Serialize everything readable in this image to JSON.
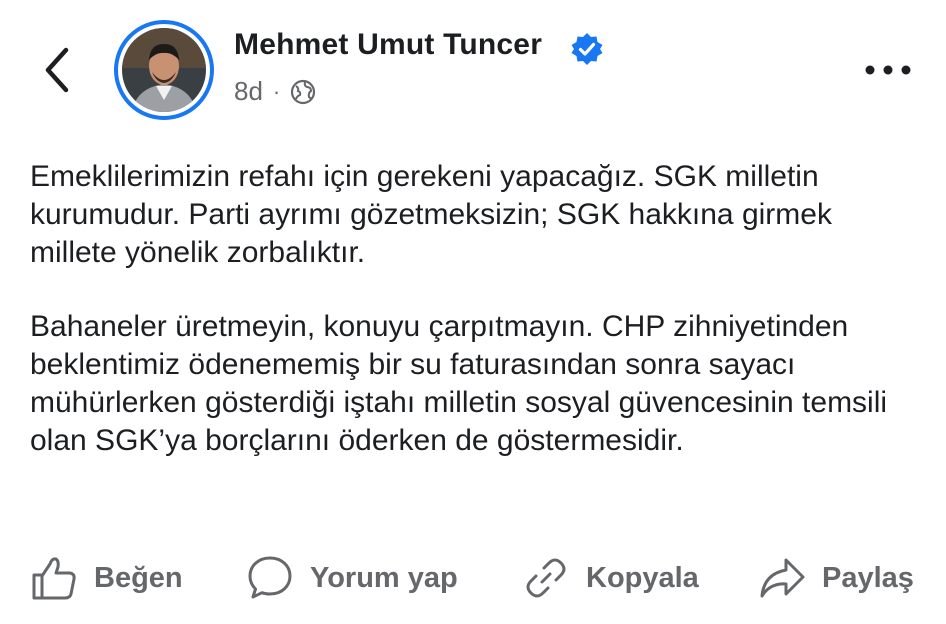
{
  "header": {
    "author_name": "Mehmet Umut Tuncer",
    "time_ago": "8d",
    "separator": "·",
    "privacy_icon": "globe-icon",
    "verified_color": "#1877f2"
  },
  "post": {
    "paragraphs": [
      "Emeklilerimizin refahı için gerekeni yapacağız. SGK milletin kurumudur. Parti ayrımı gözetmeksizin; SGK hakkına girmek millete yönelik zorbalıktır.",
      "Bahaneler üretmeyin, konuyu çarpıtmayın. CHP zihniyetinden beklentimiz ödenememiş bir su faturasından sonra sayacı mühürlerken gösterdiği iştahı milletin sosyal güvencesinin temsili olan SGK’ya borçlarını öderken de göstermesidir."
    ]
  },
  "actions": {
    "like": "Beğen",
    "comment": "Yorum yap",
    "copy": "Kopyala",
    "share": "Paylaş"
  },
  "colors": {
    "accent": "#1877f2",
    "text": "#1c1e21",
    "muted": "#65676b"
  }
}
